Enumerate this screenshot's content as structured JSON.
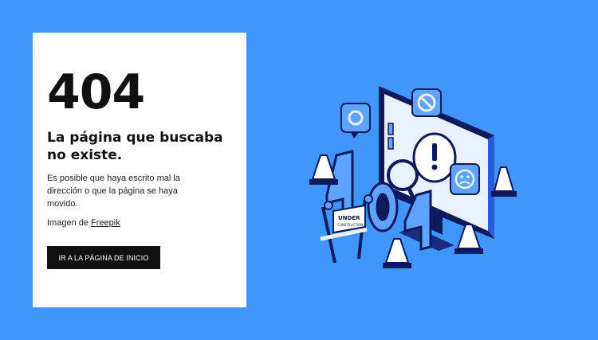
{
  "card": {
    "code": "404",
    "title": "La página que buscaba no existe.",
    "description": "Es posible que haya escrito mal la dirección o que la página se haya movido.",
    "credit_prefix": "Imagen de",
    "credit_link": "Freepik",
    "button_label": "IR A LA PÁGINA DE INICIO"
  },
  "illustration": {
    "sign_text_line1": "UNDER",
    "sign_text_line2": "CONSTRUCTION"
  },
  "colors": {
    "background": "#4096fb",
    "card": "#ffffff",
    "text": "#111111",
    "button": "#111111",
    "illustration_dark": "#0d1a5c",
    "illustration_light": "#e9f0ff",
    "illustration_accent": "#5ea4ff"
  }
}
